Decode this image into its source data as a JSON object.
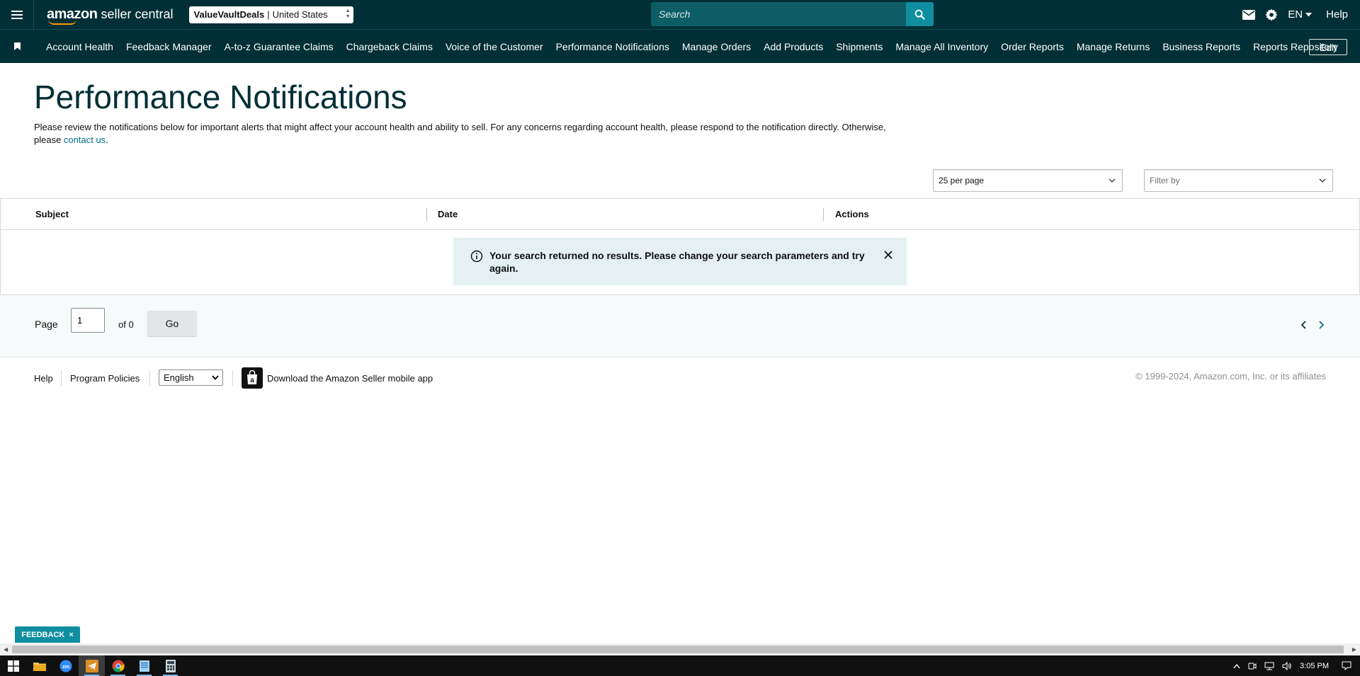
{
  "header": {
    "logo_brand": "amazon",
    "logo_product": "seller central",
    "account_store": "ValueVaultDeals",
    "account_separator": "|",
    "account_region": "United States",
    "search_placeholder": "Search",
    "language": "EN",
    "help": "Help"
  },
  "nav": {
    "items": [
      "Account Health",
      "Feedback Manager",
      "A-to-z Guarantee Claims",
      "Chargeback Claims",
      "Voice of the Customer",
      "Performance Notifications",
      "Manage Orders",
      "Add Products",
      "Shipments",
      "Manage All Inventory",
      "Order Reports",
      "Manage Returns",
      "Business Reports",
      "Reports Repository"
    ],
    "edit_label": "Edit"
  },
  "main": {
    "title": "Performance Notifications",
    "intro_text": "Please review the notifications below for important alerts that might affect your account health and ability to sell. For any concerns regarding account health, please respond to the notification directly. Otherwise, please ",
    "intro_link": "contact us",
    "intro_end": ".",
    "per_page_selected": "25 per page",
    "filter_placeholder": "Filter by",
    "table": {
      "columns": [
        "Subject",
        "Date",
        "Actions"
      ]
    },
    "alert_message": "Your search returned no results. Please change your search parameters and try again.",
    "pagination": {
      "page_label": "Page",
      "page_value": "1",
      "of_label": "of 0",
      "go_label": "Go"
    }
  },
  "footer": {
    "help": "Help",
    "program_policies": "Program Policies",
    "language_selected": "English",
    "app_download": "Download the Amazon Seller mobile app",
    "copyright": "© 1999-2024, Amazon.com, Inc. or its affiliates"
  },
  "feedback": {
    "label": "FEEDBACK",
    "close": "×"
  },
  "taskbar": {
    "clock": "3:05 PM"
  },
  "colors": {
    "header_bg": "#002f36",
    "accent": "#0f8ea0",
    "link": "#007185",
    "alert_bg": "#e4f0f1"
  }
}
